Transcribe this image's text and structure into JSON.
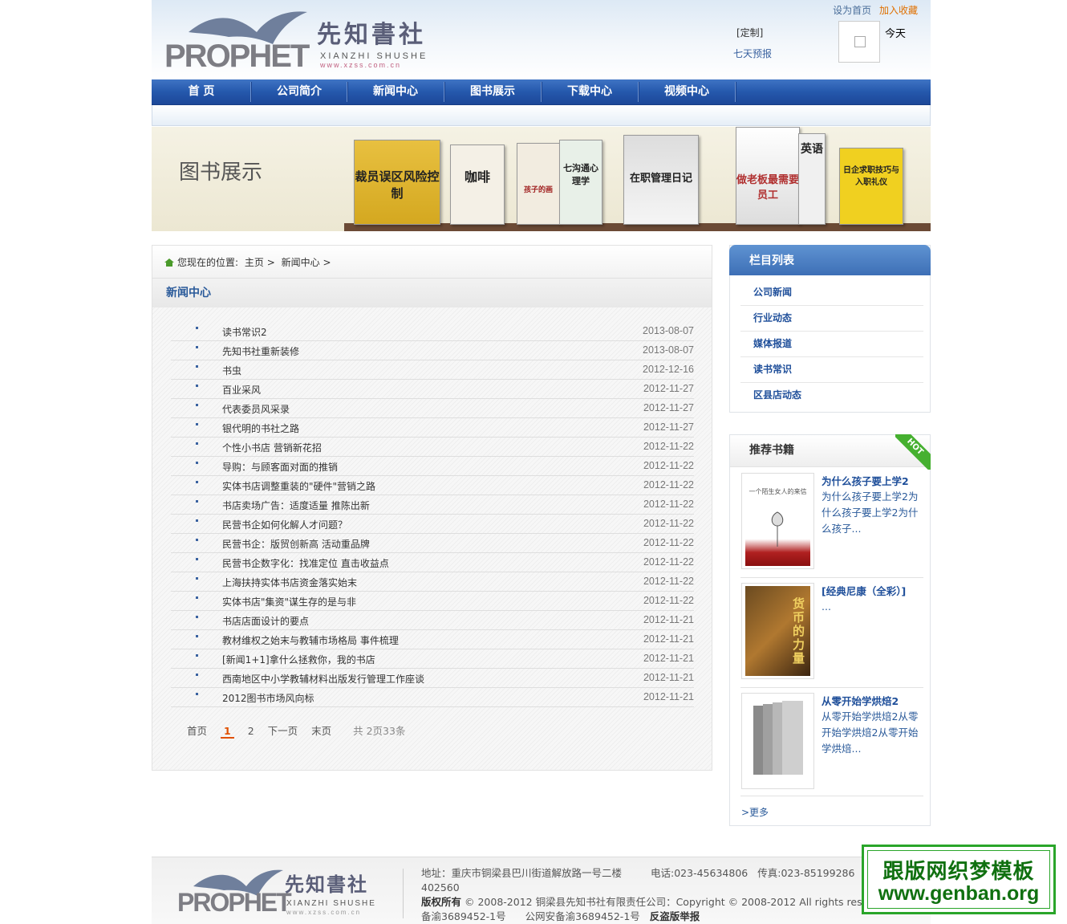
{
  "header": {
    "logo": {
      "wordmark": "PROPHET",
      "chinese": "先知書社",
      "pinyin": "XIANZHI SHUSHE",
      "url": "www.xzss.com.cn"
    },
    "top_links": {
      "set_home": "设为首页",
      "add_favorite": "加入收藏"
    },
    "weather": {
      "custom": "[定制]",
      "seven_day": "七天预报",
      "today": "今天"
    }
  },
  "nav": {
    "items": [
      "首 页",
      "公司简介",
      "新闻中心",
      "图书展示",
      "下载中心",
      "视频中心"
    ]
  },
  "banner": {
    "title": "图书展示",
    "books": [
      "裁员误区风险控制",
      "咖啡",
      "孩子的画",
      "七沟通心理学",
      "在职管理日记",
      "做老板最需要员工",
      "英语",
      "日企求职技巧与入职礼仪"
    ]
  },
  "breadcrumb": {
    "prefix": "您现在的位置:",
    "home": "主页",
    "sep": ">",
    "current": "新闻中心",
    "trail": ">"
  },
  "section_title": "新闻中心",
  "news": [
    {
      "title": "读书常识2",
      "date": "2013-08-07"
    },
    {
      "title": "先知书社重新装修",
      "date": "2013-08-07"
    },
    {
      "title": "书虫",
      "date": "2012-12-16"
    },
    {
      "title": "百业采风",
      "date": "2012-11-27"
    },
    {
      "title": "代表委员风采录",
      "date": "2012-11-27"
    },
    {
      "title": "银代明的书社之路",
      "date": "2012-11-27"
    },
    {
      "title": "个性小书店 营销新花招",
      "date": "2012-11-22"
    },
    {
      "title": "导购：与顾客面对面的推销",
      "date": "2012-11-22"
    },
    {
      "title": "实体书店调整重装的\"硬件\"营销之路",
      "date": "2012-11-22"
    },
    {
      "title": "书店卖场广告：适度适量 推陈出新",
      "date": "2012-11-22"
    },
    {
      "title": "民营书企如何化解人才问题？",
      "date": "2012-11-22"
    },
    {
      "title": "民营书企：版贸创新高 活动重品牌",
      "date": "2012-11-22"
    },
    {
      "title": "民营书企数字化：找准定位 直击收益点",
      "date": "2012-11-22"
    },
    {
      "title": "上海扶持实体书店资金落实始末",
      "date": "2012-11-22"
    },
    {
      "title": "实体书店\"集资\"谋生存的是与非",
      "date": "2012-11-22"
    },
    {
      "title": "书店店面设计的要点",
      "date": "2012-11-21"
    },
    {
      "title": "教材维权之始末与教辅市场格局 事件梳理",
      "date": "2012-11-21"
    },
    {
      "title": "[新闻1+1]拿什么拯救你，我的书店",
      "date": "2012-11-21"
    },
    {
      "title": "西南地区中小学教辅材料出版发行管理工作座谈",
      "date": "2012-11-21"
    },
    {
      "title": "2012图书市场风向标",
      "date": "2012-11-21"
    }
  ],
  "pager": {
    "first": "首页",
    "current": "1",
    "page2": "2",
    "next": "下一页",
    "last": "末页",
    "info": "共 2页33条"
  },
  "sidebar": {
    "columns_title": "栏目列表",
    "columns": [
      "公司新闻",
      "行业动态",
      "媒体报道",
      "读书常识",
      "区县店动态"
    ],
    "rec_title": "推荐书籍",
    "hot_badge": "HOT",
    "rec_books": [
      {
        "title": "为什么孩子要上学2",
        "desc": "为什么孩子要上学2为什么孩子要上学2为什么孩子...",
        "cover_text": "一个陌生女人的来信"
      },
      {
        "title": "[经典尼康（全彩）]",
        "desc": "...",
        "cover_text": "货币的力量"
      },
      {
        "title": "从零开始学烘焙2",
        "desc": "从零开始学烘焙2从零开始学烘焙2从零开始学烘焙...",
        "cover_text": ""
      }
    ],
    "more": ">更多"
  },
  "footer": {
    "address": "地址：重庆市铜梁县巴川街道解放路一号二楼",
    "phone": "电话:023-45634806",
    "fax": "传真:023-85199286",
    "postcode_label": "邮",
    "postcode": "402560",
    "copyright_label": "版权所有",
    "copyright": "© 2008-2012 铜梁县先知书社有限责任公司：Copyright © 2008-2012 All rights reserv",
    "icp": "备渝3689452-1号",
    "police": "公网安备渝3689452-1号",
    "report": "反盗版举报"
  },
  "watermark": {
    "line1": "跟版网织梦模板",
    "line2": "www.genban.org"
  },
  "colors": {
    "nav_blue": "#2558ac",
    "link_blue": "#1f4f9a",
    "accent_orange": "#e07000",
    "hot_green": "#46b030"
  }
}
